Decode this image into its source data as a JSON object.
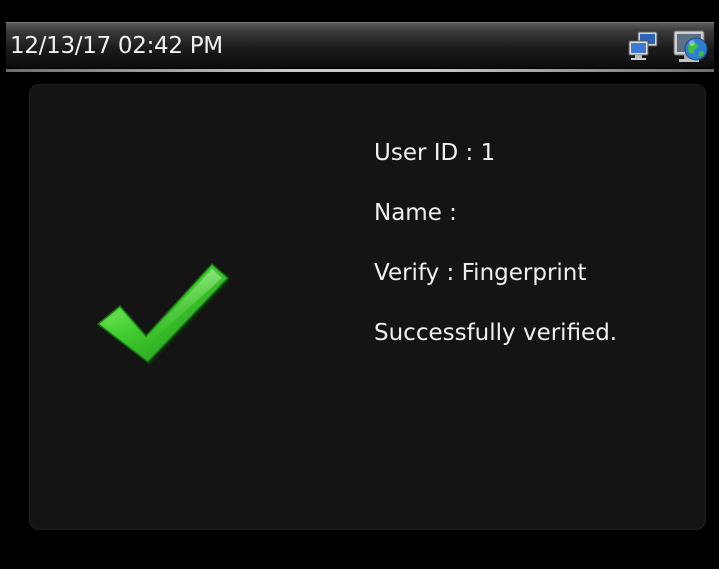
{
  "status_bar": {
    "datetime": "12/13/17 02:42 PM",
    "icons": [
      "network-icon",
      "globe-icon"
    ]
  },
  "verification": {
    "user_id": "User ID : 1",
    "name": "Name :",
    "verify_method": "Verify : Fingerprint",
    "result": "Successfully verified.",
    "result_icon": "checkmark-icon",
    "accent_color": "#2fbf2f"
  }
}
